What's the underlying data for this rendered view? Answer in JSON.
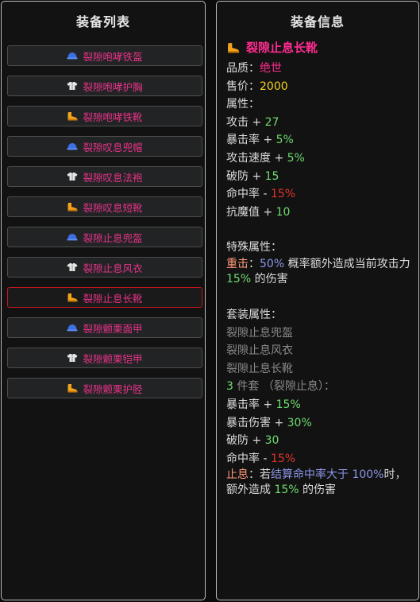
{
  "list_panel": {
    "title": "装备列表",
    "items": [
      {
        "label": "裂隙咆哮铁盔",
        "icon": "helmet-icon"
      },
      {
        "label": "裂隙咆哮护胸",
        "icon": "armor-icon"
      },
      {
        "label": "裂隙咆哮铁靴",
        "icon": "boot-icon"
      },
      {
        "label": "裂隙叹息兜帽",
        "icon": "helmet-icon"
      },
      {
        "label": "裂隙叹息法袍",
        "icon": "armor-icon"
      },
      {
        "label": "裂隙叹息短靴",
        "icon": "boot-icon"
      },
      {
        "label": "裂隙止息兜盔",
        "icon": "helmet-icon"
      },
      {
        "label": "裂隙止息风衣",
        "icon": "armor-icon"
      },
      {
        "label": "裂隙止息长靴",
        "icon": "boot-icon",
        "selected": true
      },
      {
        "label": "裂隙颤栗面甲",
        "icon": "helmet-icon"
      },
      {
        "label": "裂隙颤栗铠甲",
        "icon": "armor-icon"
      },
      {
        "label": "裂隙颤栗护胫",
        "icon": "boot-icon"
      }
    ]
  },
  "info_panel": {
    "title": "装备信息",
    "item_name": "裂隙止息长靴",
    "quality_label": "品质：",
    "quality_value": "绝世",
    "price_label": "售价：",
    "price_value": "2000",
    "attributes_header": "属性：",
    "attributes": [
      {
        "name": "攻击",
        "op": "+",
        "value": "27",
        "tone": "green"
      },
      {
        "name": "暴击率",
        "op": "+",
        "value": "5%",
        "tone": "green"
      },
      {
        "name": "攻击速度",
        "op": "+",
        "value": "5%",
        "tone": "green"
      },
      {
        "name": "破防",
        "op": "+",
        "value": "15",
        "tone": "green"
      },
      {
        "name": "命中率",
        "op": "-",
        "value": "15%",
        "tone": "red"
      },
      {
        "name": "抗魔值",
        "op": "+",
        "value": "10",
        "tone": "green"
      }
    ],
    "special_header": "特殊属性：",
    "special": {
      "name": "重击",
      "colon": "：",
      "chance": "50%",
      "text1": "概率额外造成当前攻击力",
      "pct": "15%",
      "text2": "的伤害"
    },
    "set_header": "套装属性：",
    "set_members": [
      "裂隙止息兜盔",
      "裂隙止息风衣",
      "裂隙止息长靴"
    ],
    "set_count": "3",
    "set_count_text": "件套 （裂隙止息）：",
    "set_bonuses": [
      {
        "name": "暴击率",
        "op": "+",
        "value": "15%",
        "tone": "green"
      },
      {
        "name": "暴击伤害",
        "op": "+",
        "value": "30%",
        "tone": "green"
      },
      {
        "name": "破防",
        "op": "+",
        "value": "30",
        "tone": "green"
      },
      {
        "name": "命中率",
        "op": "-",
        "value": "15%",
        "tone": "red"
      }
    ],
    "set_special": {
      "name": "止息",
      "colon": "：",
      "if_text": "若",
      "cond": "结算命中率大于 100%",
      "text1": "时，额外造成",
      "pct": "15%",
      "text2": "的伤害"
    }
  },
  "colors": {
    "accent_pink": "#ff2c8f",
    "gold": "#f4d11f",
    "positive": "#6fdc6f",
    "negative": "#e0352b",
    "special_name": "#ff9a7a",
    "condition": "#8c96e8"
  }
}
